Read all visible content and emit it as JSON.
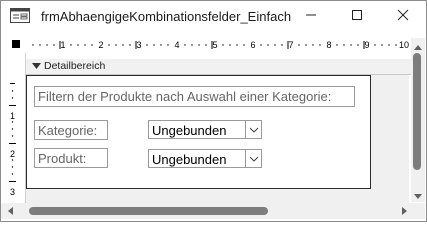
{
  "window": {
    "title": "frmAbhaengigeKombinationsfelder_Einfach",
    "icons": [
      "form-app-icon",
      "minimize-icon",
      "maximize-icon",
      "close-icon"
    ]
  },
  "ruler": {
    "horizontal_labels": [
      "1",
      "2",
      "3",
      "4",
      "5",
      "6",
      "7",
      "8",
      "9",
      "10"
    ],
    "vertical_labels": [
      "1",
      "2",
      "3"
    ]
  },
  "section": {
    "label": "Detailbereich",
    "icon": "section-collapse-icon"
  },
  "form": {
    "heading_label": "Filtern der Produkte nach Auswahl einer Kategorie:",
    "kategorie_label": "Kategorie:",
    "kategorie_combo_value": "Ungebunden",
    "produkt_label": "Produkt:",
    "produkt_combo_value": "Ungebunden"
  },
  "colors": {
    "form_border": "#2b2b2b",
    "control_border": "#9a9a9a",
    "label_text": "#666666",
    "scroll_thumb": "#7d7d7d",
    "designer_background": "#f0f0f0"
  }
}
